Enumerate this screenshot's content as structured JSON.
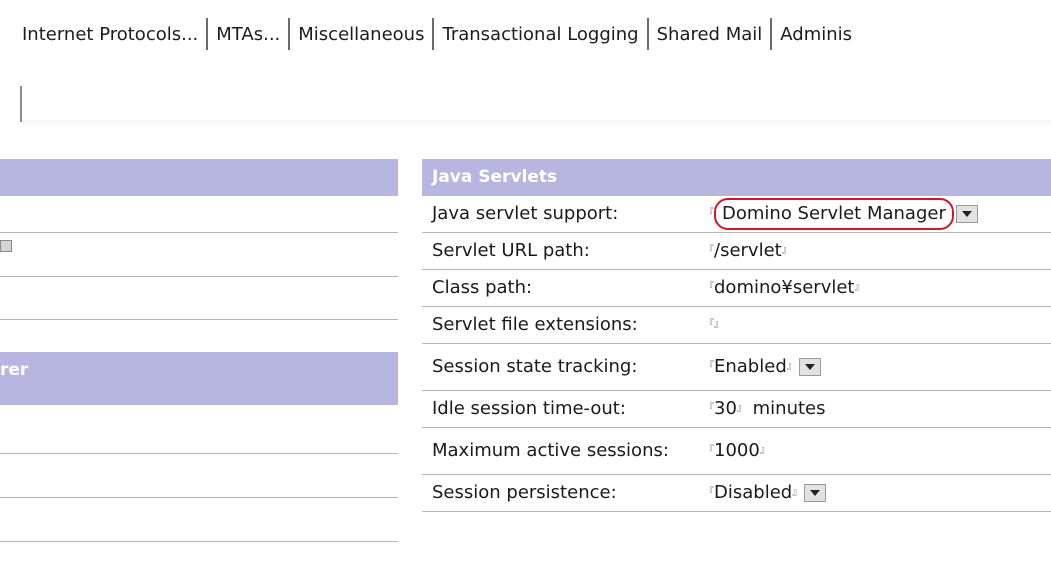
{
  "tabs": [
    "Internet Protocols...",
    "MTAs...",
    "Miscellaneous",
    "Transactional Logging",
    "Shared Mail",
    "Adminis"
  ],
  "left_section": {
    "header_partial": "rer"
  },
  "java_servlets": {
    "header": "Java Servlets",
    "rows": [
      {
        "label": "Java servlet support:",
        "value": "Domino Servlet Manager",
        "suffix": "",
        "type": "dropdown"
      },
      {
        "label": "Servlet URL path:",
        "value": "/servlet",
        "suffix": "",
        "type": "text"
      },
      {
        "label": "Class path:",
        "value": "domino¥servlet",
        "suffix": "",
        "type": "text"
      },
      {
        "label": "Servlet file extensions:",
        "value": "",
        "suffix": "",
        "type": "text"
      },
      {
        "label": "Session state tracking:",
        "value": "Enabled",
        "suffix": "",
        "type": "dropdown"
      },
      {
        "label": "Idle session time-out:",
        "value": "30",
        "suffix": "minutes",
        "type": "text"
      },
      {
        "label": "Maximum active sessions:",
        "value": "1000",
        "suffix": "",
        "type": "text"
      },
      {
        "label": "Session persistence:",
        "value": "Disabled",
        "suffix": "",
        "type": "dropdown"
      }
    ]
  },
  "colors": {
    "section_header": "#b6b6e0",
    "highlight_circle": "#d0182a"
  }
}
